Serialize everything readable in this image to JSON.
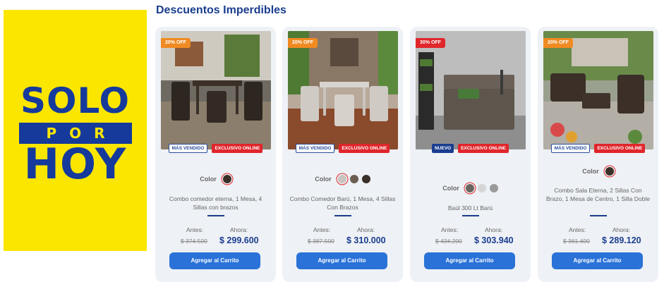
{
  "promo": {
    "line1": "SOLO",
    "line2": "POR",
    "line3": "HOY"
  },
  "section": {
    "title": "Descuentos Imperdibles"
  },
  "labels": {
    "color": "Color",
    "before": "Antes:",
    "now": "Ahora:",
    "add_to_cart": "Agregar al Carrito"
  },
  "products": [
    {
      "discount": "20% OFF",
      "discount_color": "#f08a22",
      "badges": [
        {
          "text": "MÁS VENDIDO",
          "kind": "best"
        },
        {
          "text": "EXCLUSIVO ONLINE",
          "kind": "excl"
        }
      ],
      "colors": [
        "#3a3029"
      ],
      "name": "Combo comedor eterna, 1 Mesa, 4 Sillas con brazos",
      "price_before": "$ 374.500",
      "price_now": "$ 299.600"
    },
    {
      "discount": "20% OFF",
      "discount_color": "#f08a22",
      "badges": [
        {
          "text": "MÁS VENDIDO",
          "kind": "best"
        },
        {
          "text": "EXCLUSIVO ONLINE",
          "kind": "excl"
        }
      ],
      "colors": [
        "#c9c4be",
        "#6b5e52",
        "#3a3029"
      ],
      "name": "Combo Comedor Barú, 1 Mesa, 4 Sillas Con Brazos",
      "price_before": "$ 387.500",
      "price_now": "$ 310.000"
    },
    {
      "discount": "30% OFF",
      "discount_color": "#e0262b",
      "badges": [
        {
          "text": "NUEVO",
          "kind": "new"
        },
        {
          "text": "EXCLUSIVO ONLINE",
          "kind": "excl"
        }
      ],
      "colors": [
        "#6b6560",
        "#d6d6d6",
        "#9a9a9a"
      ],
      "name": "Baúl 300 Lt Barú",
      "price_before": "$ 434.200",
      "price_now": "$ 303.940"
    },
    {
      "discount": "20% OFF",
      "discount_color": "#f08a22",
      "badges": [
        {
          "text": "MÁS VENDIDO",
          "kind": "best"
        },
        {
          "text": "EXCLUSIVO ONLINE",
          "kind": "excl"
        }
      ],
      "colors": [
        "#3a3029"
      ],
      "name": "Combo Sala Eterna, 2 Sillas Con Brazo, 1 Mesa de Centro, 1 Silla Doble",
      "price_before": "$ 361.400",
      "price_now": "$ 289.120"
    }
  ]
}
